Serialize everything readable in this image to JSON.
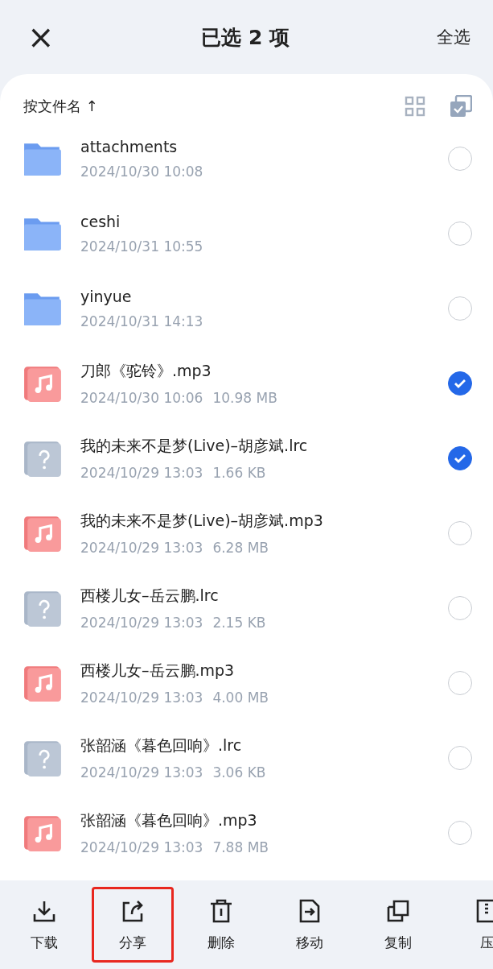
{
  "header": {
    "close": "×",
    "title": "已选 2 项",
    "select_all": "全选"
  },
  "sort": {
    "label": "按文件名",
    "arrow": "↑"
  },
  "files": [
    {
      "kind": "folder",
      "name": "attachments",
      "date": "2024/10/30 10:08",
      "selected": false
    },
    {
      "kind": "folder",
      "name": "ceshi",
      "date": "2024/10/31 10:55",
      "selected": false
    },
    {
      "kind": "folder",
      "name": "yinyue",
      "date": "2024/10/31 14:13",
      "selected": false
    },
    {
      "kind": "audio",
      "name": "刀郎《驼铃》.mp3",
      "date": "2024/10/30 10:06",
      "size": "10.98 MB",
      "selected": true
    },
    {
      "kind": "unknown",
      "name": "我的未来不是梦(Live)–胡彦斌.lrc",
      "date": "2024/10/29 13:03",
      "size": "1.66 KB",
      "selected": true
    },
    {
      "kind": "audio",
      "name": "我的未来不是梦(Live)–胡彦斌.mp3",
      "date": "2024/10/29 13:03",
      "size": "6.28 MB",
      "selected": false
    },
    {
      "kind": "unknown",
      "name": "西楼儿女–岳云鹏.lrc",
      "date": "2024/10/29 13:03",
      "size": "2.15 KB",
      "selected": false
    },
    {
      "kind": "audio",
      "name": "西楼儿女–岳云鹏.mp3",
      "date": "2024/10/29 13:03",
      "size": "4.00 MB",
      "selected": false
    },
    {
      "kind": "unknown",
      "name": "张韶涵《暮色回响》.lrc",
      "date": "2024/10/29 13:03",
      "size": "3.06 KB",
      "selected": false
    },
    {
      "kind": "audio",
      "name": "张韶涵《暮色回响》.mp3",
      "date": "2024/10/29 13:03",
      "size": "7.88 MB",
      "selected": false
    }
  ],
  "toolbar": [
    {
      "kind": "download",
      "label": "下载",
      "highlighted": false
    },
    {
      "kind": "share",
      "label": "分享",
      "highlighted": true
    },
    {
      "kind": "delete",
      "label": "删除",
      "highlighted": false
    },
    {
      "kind": "move",
      "label": "移动",
      "highlighted": false
    },
    {
      "kind": "copy",
      "label": "复制",
      "highlighted": false
    },
    {
      "kind": "compress",
      "label": "压",
      "highlighted": false
    }
  ]
}
